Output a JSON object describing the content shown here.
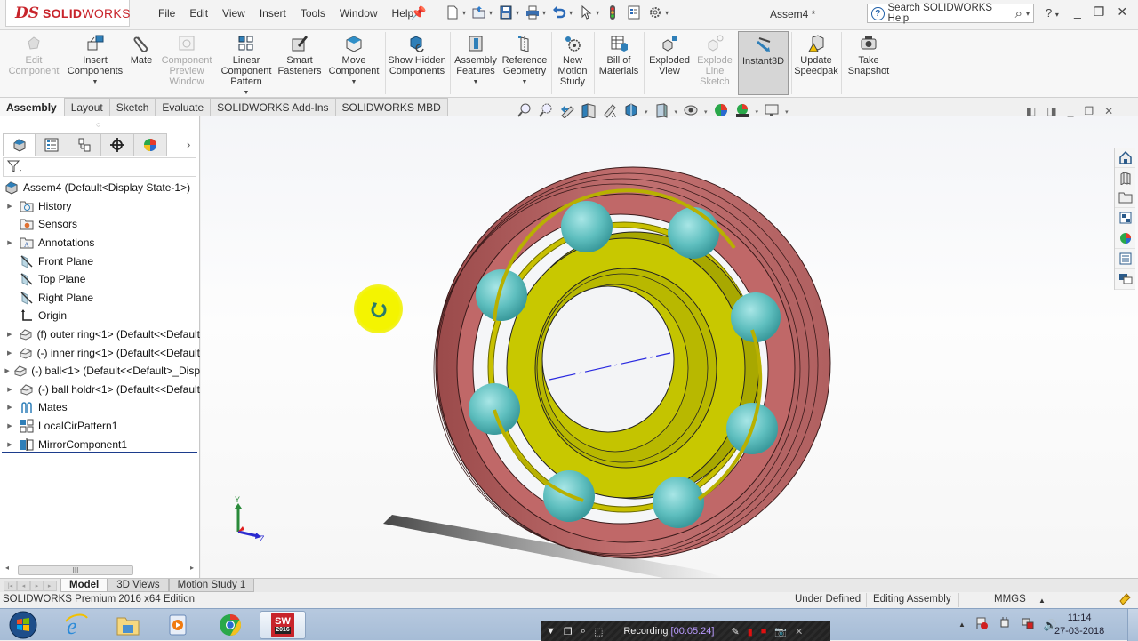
{
  "app": {
    "brand_prefix": "DS",
    "brand_bold": "SOLID",
    "brand_light": "WORKS",
    "document_title": "Assem4 *"
  },
  "menu": [
    "File",
    "Edit",
    "View",
    "Insert",
    "Tools",
    "Window",
    "Help"
  ],
  "quick_access": [
    {
      "icon": "new-document-icon"
    },
    {
      "icon": "open-folder-icon"
    },
    {
      "icon": "save-icon"
    },
    {
      "icon": "print-icon"
    },
    {
      "icon": "undo-icon"
    },
    {
      "icon": "select-arrow-icon"
    },
    {
      "icon": "rebuild-traffic-light-icon"
    },
    {
      "icon": "file-properties-icon"
    },
    {
      "icon": "options-gear-icon"
    }
  ],
  "search": {
    "placeholder": "Search SOLIDWORKS Help"
  },
  "window_controls": {
    "help": "?",
    "minimize": "_",
    "restore": "❐",
    "close": "✕"
  },
  "command_manager": {
    "tools": [
      {
        "label": "Edit Component",
        "enabled": false
      },
      {
        "label": "Insert Components",
        "enabled": true,
        "dropdown": true
      },
      {
        "label": "Mate",
        "enabled": true
      },
      {
        "label": "Component Preview Window",
        "enabled": false
      },
      {
        "label": "Linear Component Pattern",
        "enabled": true,
        "dropdown": true
      },
      {
        "label": "Smart Fasteners",
        "enabled": true
      },
      {
        "label": "Move Component",
        "enabled": true,
        "dropdown": true
      },
      {
        "label": "Show Hidden Components",
        "enabled": true
      },
      {
        "label": "Assembly Features",
        "enabled": true,
        "dropdown": true
      },
      {
        "label": "Reference Geometry",
        "enabled": true,
        "dropdown": true
      },
      {
        "label": "New Motion Study",
        "enabled": true
      },
      {
        "label": "Bill of Materials",
        "enabled": true
      },
      {
        "label": "Exploded View",
        "enabled": true
      },
      {
        "label": "Explode Line Sketch",
        "enabled": false
      },
      {
        "label": "Instant3D",
        "enabled": true,
        "active": true
      },
      {
        "label": "Update Speedpak",
        "enabled": true
      },
      {
        "label": "Take Snapshot",
        "enabled": true
      }
    ],
    "tabs": [
      {
        "label": "Assembly",
        "active": true
      },
      {
        "label": "Layout"
      },
      {
        "label": "Sketch"
      },
      {
        "label": "Evaluate"
      },
      {
        "label": "SOLIDWORKS Add-Ins"
      },
      {
        "label": "SOLIDWORKS MBD"
      }
    ]
  },
  "feature_manager": {
    "panel_tabs": [
      "feature-manager-tab",
      "property-manager-tab",
      "configuration-manager-tab",
      "dimxpert-manager-tab",
      "display-manager-tab"
    ],
    "root": "Assem4  (Default<Display State-1>)",
    "items": [
      {
        "label": "History",
        "icon": "history-folder-icon",
        "expandable": true
      },
      {
        "label": "Sensors",
        "icon": "sensors-folder-icon",
        "expandable": false
      },
      {
        "label": "Annotations",
        "icon": "annotations-folder-icon",
        "expandable": true
      },
      {
        "label": "Front Plane",
        "icon": "plane-icon",
        "expandable": false
      },
      {
        "label": "Top Plane",
        "icon": "plane-icon",
        "expandable": false
      },
      {
        "label": "Right Plane",
        "icon": "plane-icon",
        "expandable": false
      },
      {
        "label": "Origin",
        "icon": "origin-icon",
        "expandable": false
      },
      {
        "label": "(f) outer ring<1> (Default<<Default",
        "icon": "part-icon",
        "expandable": true
      },
      {
        "label": "(-) inner ring<1> (Default<<Default",
        "icon": "part-icon",
        "expandable": true
      },
      {
        "label": "(-) ball<1> (Default<<Default>_Disp",
        "icon": "part-icon",
        "expandable": true
      },
      {
        "label": "(-) ball holdr<1> (Default<<Default",
        "icon": "part-icon",
        "expandable": true
      },
      {
        "label": "Mates",
        "icon": "mates-icon",
        "expandable": true
      },
      {
        "label": "LocalCirPattern1",
        "icon": "circular-pattern-icon",
        "expandable": true
      },
      {
        "label": "MirrorComponent1",
        "icon": "mirror-component-icon",
        "expandable": true
      }
    ],
    "scroll_grip": "III"
  },
  "viewport": {
    "heads_up_toolbar": [
      "zoom-to-fit-icon",
      "zoom-to-area-icon",
      "previous-view-icon",
      "section-view-icon",
      "dynamic-annotation-icon",
      "view-orientation-icon",
      "display-style-icon",
      "hide-show-items-icon",
      "edit-appearance-icon",
      "apply-scene-icon",
      "view-settings-icon"
    ],
    "triad": {
      "y_label": "Y",
      "z_label": "Z"
    },
    "task_pane": [
      "solidworks-resources-icon",
      "design-library-icon",
      "file-explorer-icon",
      "view-palette-icon",
      "appearances-scenes-icon",
      "custom-properties-icon",
      "solidworks-forum-icon"
    ],
    "colors": {
      "outer_ring": "#b86464",
      "inner_ring": "#c8c800",
      "balls": "#5fbfbf",
      "cage": "#b8b000"
    }
  },
  "bottom_tabs": [
    {
      "label": "Model",
      "active": true
    },
    {
      "label": "3D Views"
    },
    {
      "label": "Motion Study 1"
    }
  ],
  "status_bar": {
    "edition": "SOLIDWORKS Premium 2016 x64 Edition",
    "definition": "Under Defined",
    "mode": "Editing Assembly",
    "units": "MMGS",
    "units_arrow": "▲"
  },
  "taskbar": {
    "apps": [
      "start-button",
      "internet-explorer",
      "file-explorer",
      "media-player",
      "chrome",
      "solidworks-2016"
    ],
    "sw_badge_top": "SW",
    "sw_badge_bottom": "2016",
    "recording_label": "Recording",
    "recording_time": "[00:05:24]",
    "clock_time": "11:14",
    "clock_date": "27-03-2018"
  }
}
